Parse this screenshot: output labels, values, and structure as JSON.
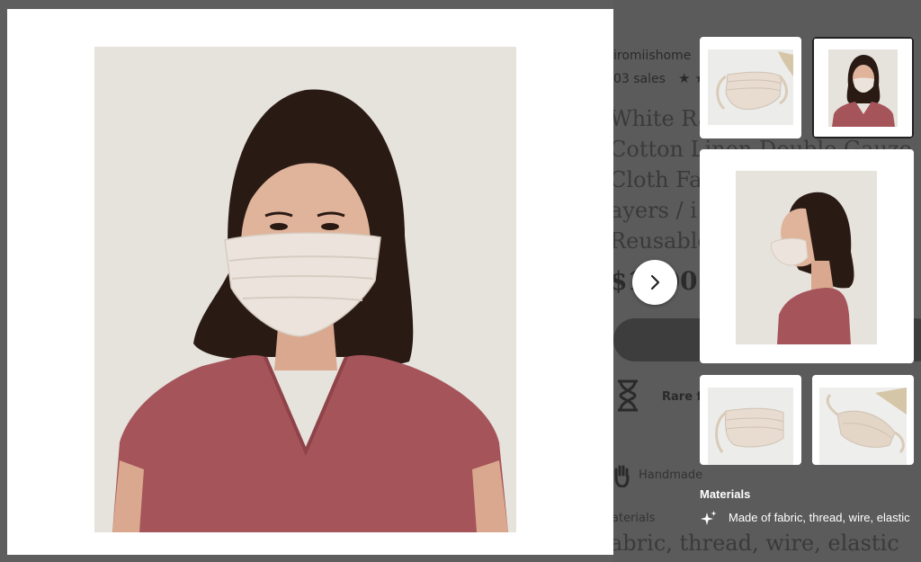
{
  "background_page": {
    "shop_name": "iromiishome",
    "sales": "03 sales",
    "stars": "★ ★",
    "title_lines": [
      "White Ra",
      "Cotton Linen Double Gauze",
      "Cloth Fab",
      "ayers / i",
      "Reusable"
    ],
    "price": "$1  .00",
    "rare_find": "Rare fi",
    "handmade": "Handmade",
    "materials_label": "aterials",
    "materials_value": "abric, thread, wire, elastic"
  },
  "viewer": {
    "main_image_alt": "Woman with shoulder-length dark hair wearing a white linen pleated face mask and a rose t-shirt"
  },
  "thumbnails": [
    {
      "id": "mask-flat",
      "selected": false
    },
    {
      "id": "woman-front",
      "selected": true
    },
    {
      "id": "woman-profile",
      "selected": false
    },
    {
      "id": "mask-side",
      "selected": false
    },
    {
      "id": "mask-inside",
      "selected": false
    }
  ],
  "materials_panel": {
    "heading": "Materials",
    "icon": "sparkle-icon",
    "text": "Made of fabric, thread, wire, elastic"
  },
  "next_button": {
    "icon": "chevron-right-icon"
  },
  "colors": {
    "overlay": "#5e5e5e",
    "shirt": "#a5545a",
    "hair": "#2a1a14",
    "mask": "#ece4dc",
    "wall": "#e6e2dc"
  }
}
